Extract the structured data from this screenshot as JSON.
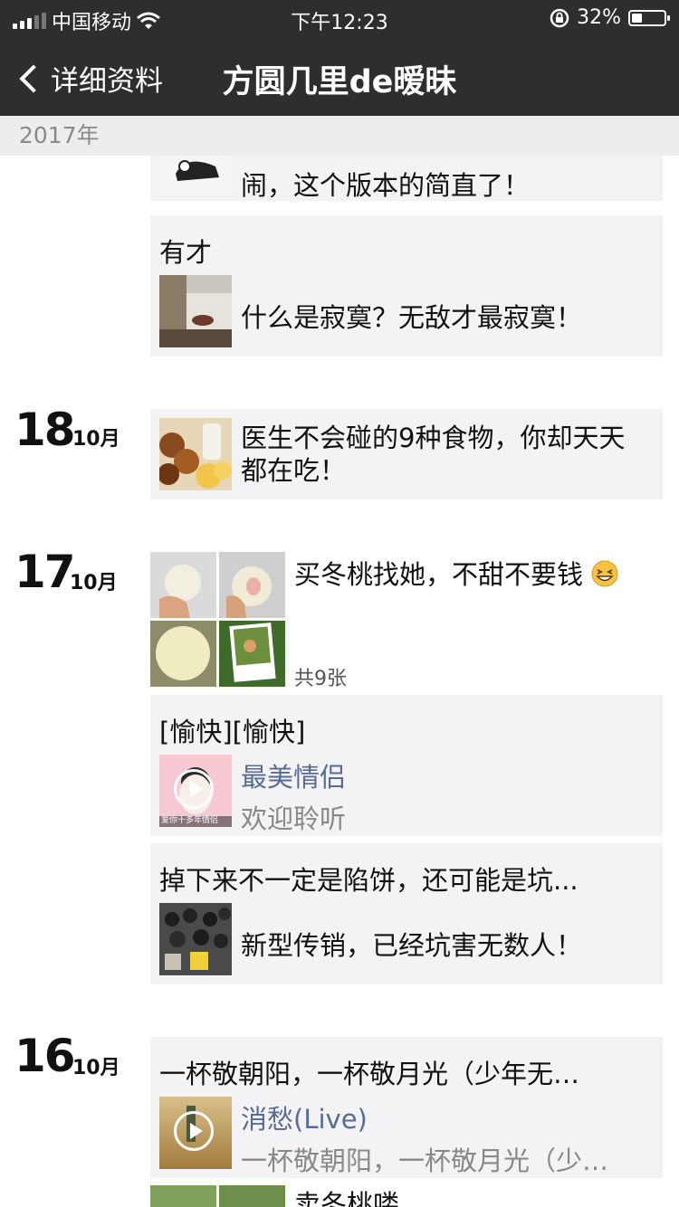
{
  "status": {
    "carrier": "中国移动",
    "time": "下午12:23",
    "battery": "32%",
    "battery_level": 0.32
  },
  "nav": {
    "back_label": "详细资料",
    "title": "方圆几里de暧昧"
  },
  "year_header": "2017年",
  "posts": {
    "p0": {
      "text": "闹，这个版本的简直了！"
    },
    "p1": {
      "caption": "有才",
      "link_text": "什么是寂寞？无敌才最寂寞！"
    },
    "d18": {
      "day": "18",
      "month": "10月",
      "link_text": "医生不会碰的9种食物，你却天天都在吃！"
    },
    "d17": {
      "day": "17",
      "month": "10月",
      "photo_text": "买冬桃找她，不甜不要钱",
      "photo_count": "共9张",
      "music": {
        "caption": "[愉快][愉快]",
        "title": "最美情侣",
        "subtitle": "欢迎聆听",
        "thumb_text": "爱你十多年情侣"
      },
      "link": {
        "caption": "掉下来不一定是陷饼，还可能是坑...",
        "link_text": "新型传销，已经坑害无数人！"
      }
    },
    "d16": {
      "day": "16",
      "month": "10月",
      "music": {
        "caption": "一杯敬朝阳，一杯敬月光（少年无…",
        "title": "消愁(Live)",
        "subtitle": "一杯敬朝阳，一杯敬月光（少…"
      },
      "next_text": "卖冬桃喽"
    }
  },
  "colors": {
    "bar": "#2e2e2f",
    "card": "#f3f3f5",
    "link_blue": "#576b95",
    "grey_text": "#888888"
  }
}
